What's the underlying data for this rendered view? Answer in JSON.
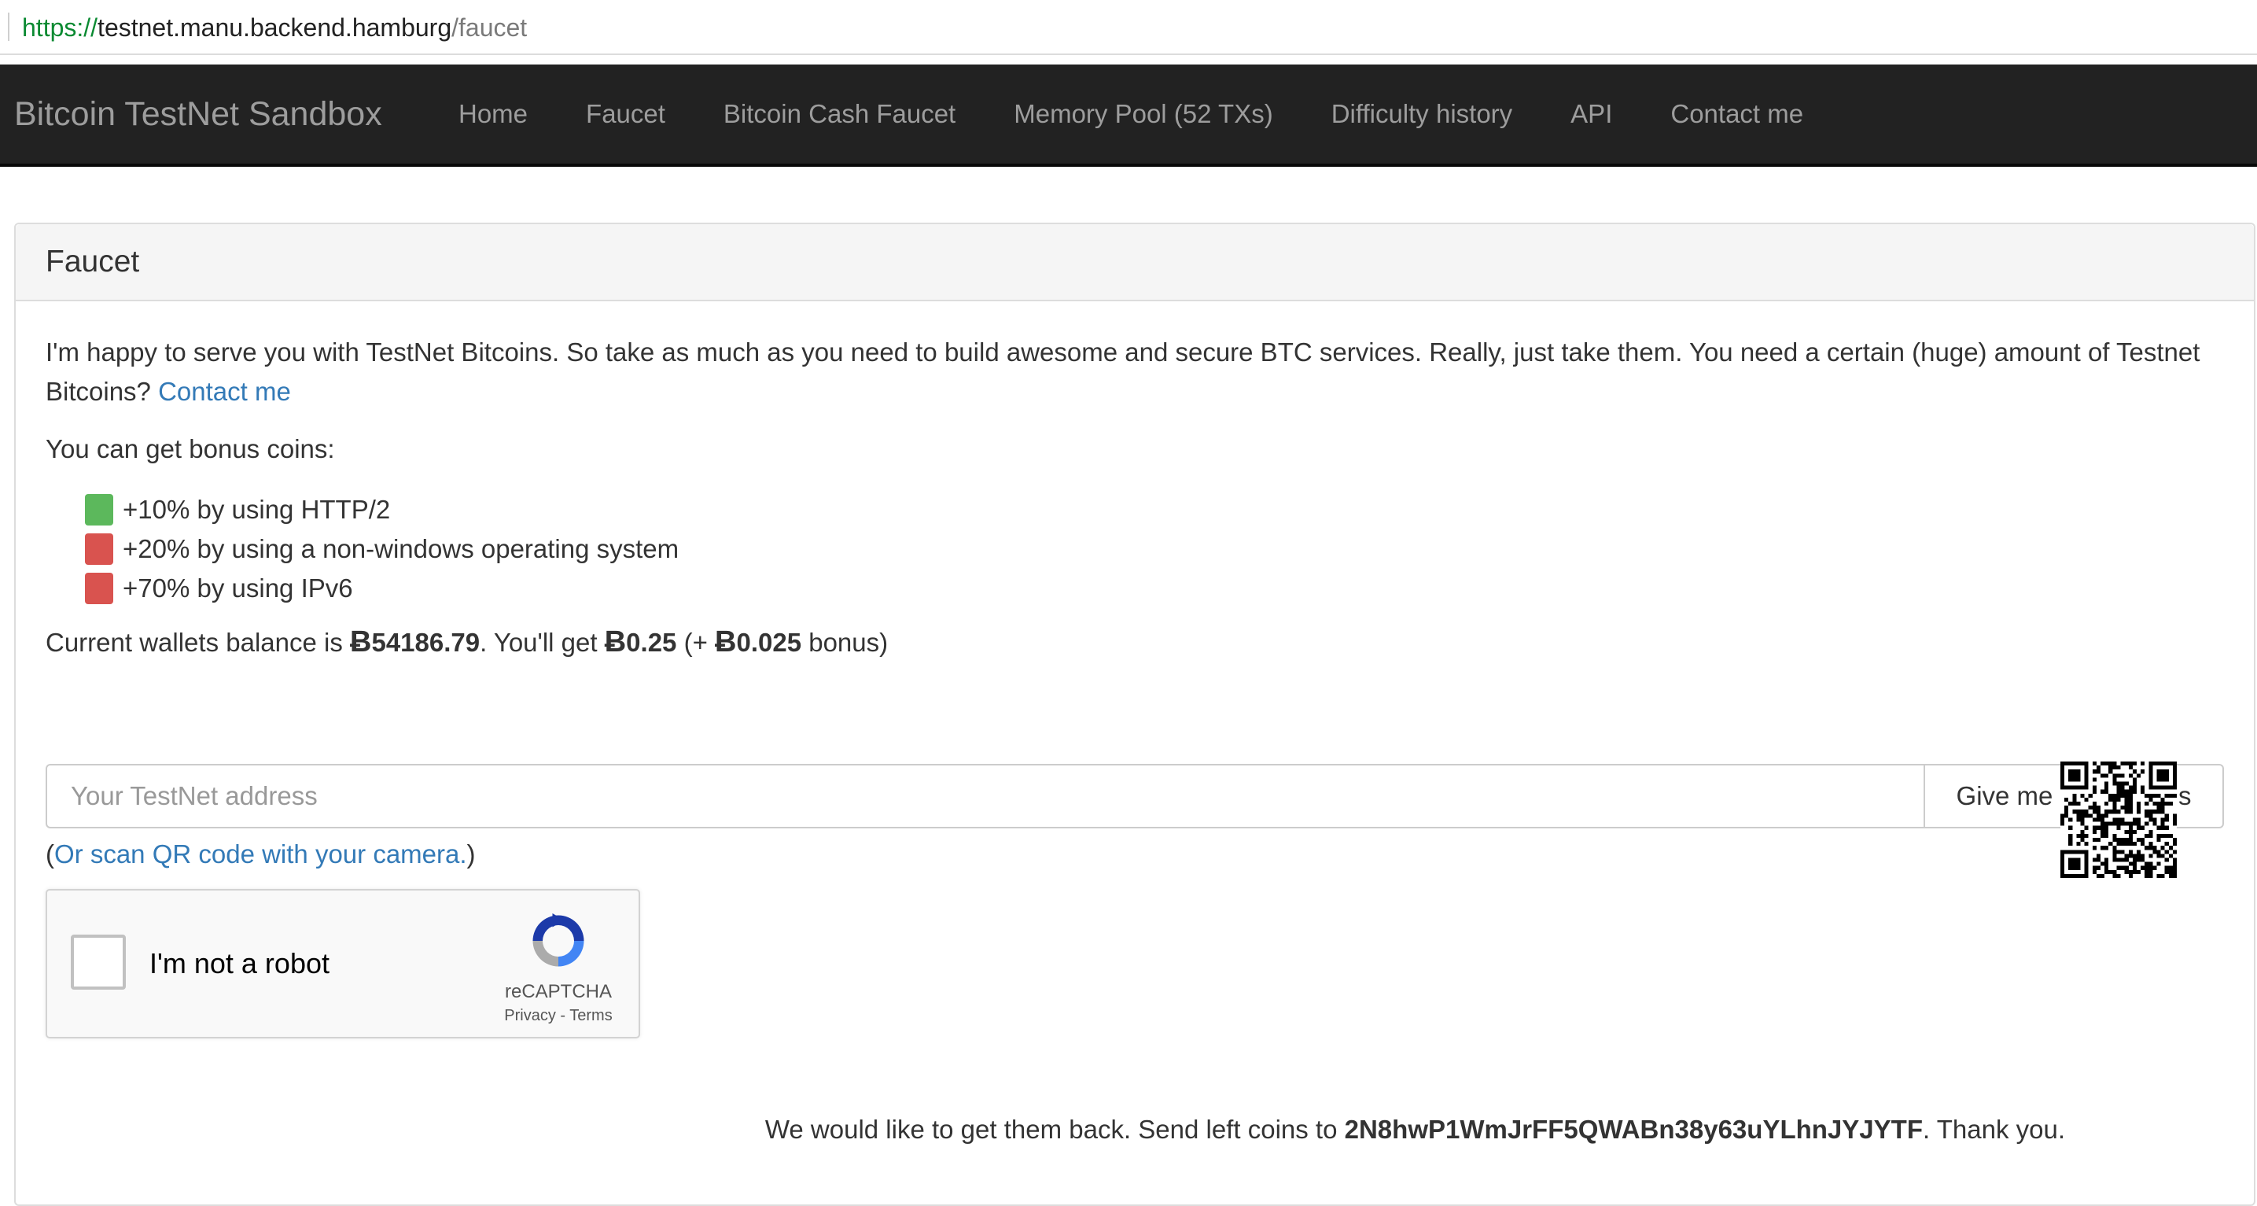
{
  "url": {
    "scheme": "https://",
    "host": "testnet.manu.backend.hamburg",
    "path": "/faucet"
  },
  "navbar": {
    "brand": "Bitcoin TestNet Sandbox",
    "items": [
      {
        "label": "Home"
      },
      {
        "label": "Faucet"
      },
      {
        "label": "Bitcoin Cash Faucet"
      },
      {
        "label": "Memory Pool (52 TXs)"
      },
      {
        "label": "Difficulty history"
      },
      {
        "label": "API"
      },
      {
        "label": "Contact me"
      }
    ]
  },
  "panel": {
    "title": "Faucet",
    "intro_text": "I'm happy to serve you with TestNet Bitcoins. So take as much as you need to build awesome and secure BTC services. Really, just take them. You need a certain (huge) amount of Testnet Bitcoins?",
    "intro_link": "Contact me",
    "bonus_title": "You can get bonus coins:",
    "bonuses": [
      {
        "text": "+10% by using HTTP/2",
        "status_color": "#5cb85c"
      },
      {
        "text": "+20% by using a non-windows operating system",
        "status_color": "#d9534f"
      },
      {
        "text": "+70% by using IPv6",
        "status_color": "#d9534f"
      }
    ],
    "balance": {
      "prefix": "Current wallets balance is ",
      "symbol": "Ƀ",
      "balance_value": "54186.79",
      "get_text": ". You'll get ",
      "amount": "0.25",
      "bonus_open": " (+ ",
      "bonus_amount": "0.025",
      "bonus_close": " bonus)"
    },
    "address_input": {
      "placeholder": "Your TestNet address",
      "value": ""
    },
    "give_button": "Give me some coins",
    "scan": {
      "open": "(",
      "link": "Or scan QR code with your camera.",
      "close": ")"
    },
    "captcha": {
      "label": "I'm not a robot",
      "brand": "reCAPTCHA",
      "links": "Privacy - Terms"
    },
    "sendback": {
      "text": "We would like to get them back. Send left coins to ",
      "address": "2N8hwP1WmJrFF5QWABn38y63uYLhnJYJYTF",
      "thanks": ". Thank you."
    }
  },
  "colors": {
    "link": "#337ab7",
    "navbar_bg": "#222222",
    "url_scheme": "#0b8a32"
  }
}
